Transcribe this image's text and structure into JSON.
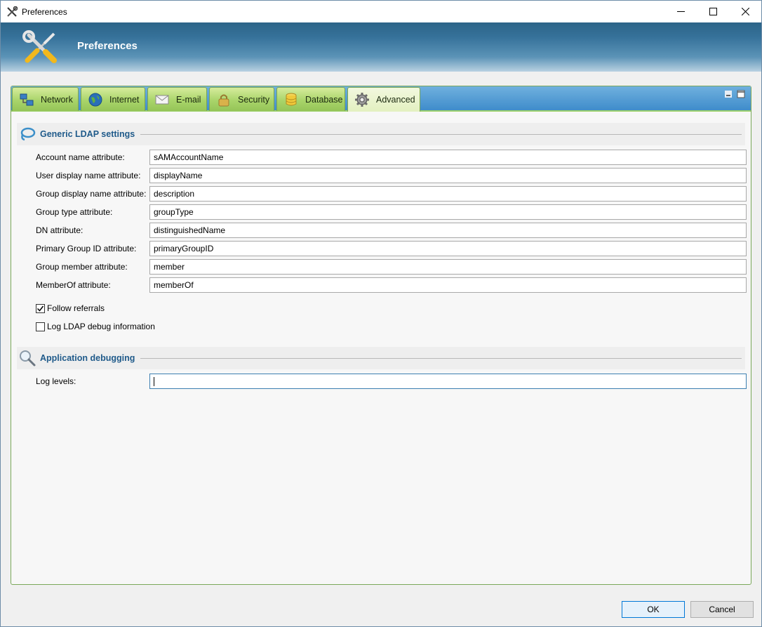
{
  "window": {
    "title": "Preferences"
  },
  "header": {
    "title": "Preferences"
  },
  "tabs": [
    {
      "label": "Network",
      "icon": "network-icon"
    },
    {
      "label": "Internet",
      "icon": "globe-icon"
    },
    {
      "label": "E-mail",
      "icon": "envelope-icon"
    },
    {
      "label": "Security",
      "icon": "lock-icon"
    },
    {
      "label": "Database",
      "icon": "database-icon"
    },
    {
      "label": "Advanced",
      "icon": "gear-icon",
      "active": true
    }
  ],
  "ldap": {
    "title": "Generic LDAP settings",
    "fields": [
      {
        "label": "Account name attribute:",
        "value": "sAMAccountName"
      },
      {
        "label": "User display name attribute:",
        "value": "displayName"
      },
      {
        "label": "Group display name attribute:",
        "value": "description"
      },
      {
        "label": "Group type attribute:",
        "value": "groupType"
      },
      {
        "label": "DN attribute:",
        "value": "distinguishedName"
      },
      {
        "label": "Primary Group ID attribute:",
        "value": "primaryGroupID"
      },
      {
        "label": "Group member attribute:",
        "value": "member"
      },
      {
        "label": "MemberOf attribute:",
        "value": "memberOf"
      }
    ],
    "follow_referrals": {
      "label": "Follow referrals",
      "checked": true
    },
    "log_debug": {
      "label": "Log LDAP debug information",
      "checked": false
    }
  },
  "debugging": {
    "title": "Application debugging",
    "log_levels_label": "Log levels:",
    "log_levels_value": ""
  },
  "buttons": {
    "ok": "OK",
    "cancel": "Cancel"
  },
  "colors": {
    "header_blue": "#36729a",
    "tab_green": "#a9d46a",
    "section_title": "#1f5a8a"
  }
}
